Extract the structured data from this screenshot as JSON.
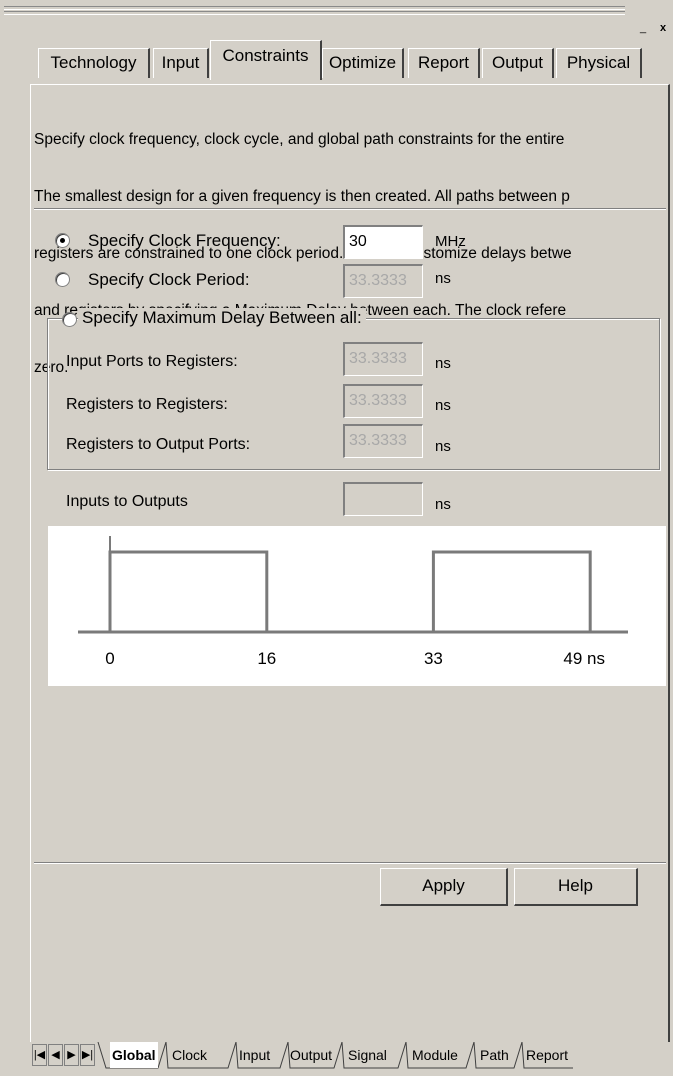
{
  "titlebar": {
    "minimize_glyph": "_",
    "close_glyph": "x"
  },
  "tabs": [
    {
      "label": "Technology"
    },
    {
      "label": "Input"
    },
    {
      "label": "Constraints"
    },
    {
      "label": "Optimize"
    },
    {
      "label": "Report"
    },
    {
      "label": "Output"
    },
    {
      "label": "Physical"
    }
  ],
  "description": [
    "Specify clock frequency, clock cycle, and global path constraints for the entire",
    "The smallest design for a given frequency is then created. All paths between p",
    "registers are constrained to one clock period. You can customize delays betwe",
    "and registers by specifying a Maximum Delay between each. The clock refere",
    "zero."
  ],
  "form": {
    "clock_frequency": {
      "label": "Specify Clock Frequency:",
      "value": "30",
      "unit": "MHz",
      "selected": true
    },
    "clock_period": {
      "label": "Specify Clock Period:",
      "value": "33.3333",
      "unit": "ns",
      "selected": false
    },
    "max_delay": {
      "label": "Specify Maximum Delay Between all:",
      "selected": false
    },
    "input_to_reg": {
      "label": "Input Ports to Registers:",
      "value": "33.3333",
      "unit": "ns"
    },
    "reg_to_reg": {
      "label": "Registers to Registers:",
      "value": "33.3333",
      "unit": "ns"
    },
    "reg_to_out": {
      "label": "Registers to Output Ports:",
      "value": "33.3333",
      "unit": "ns"
    },
    "inputs_to_outputs": {
      "label": "Inputs to Outputs",
      "value": "",
      "unit": "ns"
    }
  },
  "waveform": {
    "ticks": [
      "0",
      "16",
      "33",
      "49 ns"
    ],
    "periods": [
      {
        "rise": 0,
        "fall": 16
      },
      {
        "rise": 33,
        "fall": 49
      }
    ]
  },
  "buttons": {
    "apply": "Apply",
    "help": "Help"
  },
  "bottom_tabs": [
    "Global",
    "Clock",
    "Input",
    "Output",
    "Signal",
    "Module",
    "Path",
    "Report"
  ],
  "nav_icons": [
    "first-icon",
    "prev-icon",
    "next-icon",
    "last-icon"
  ]
}
